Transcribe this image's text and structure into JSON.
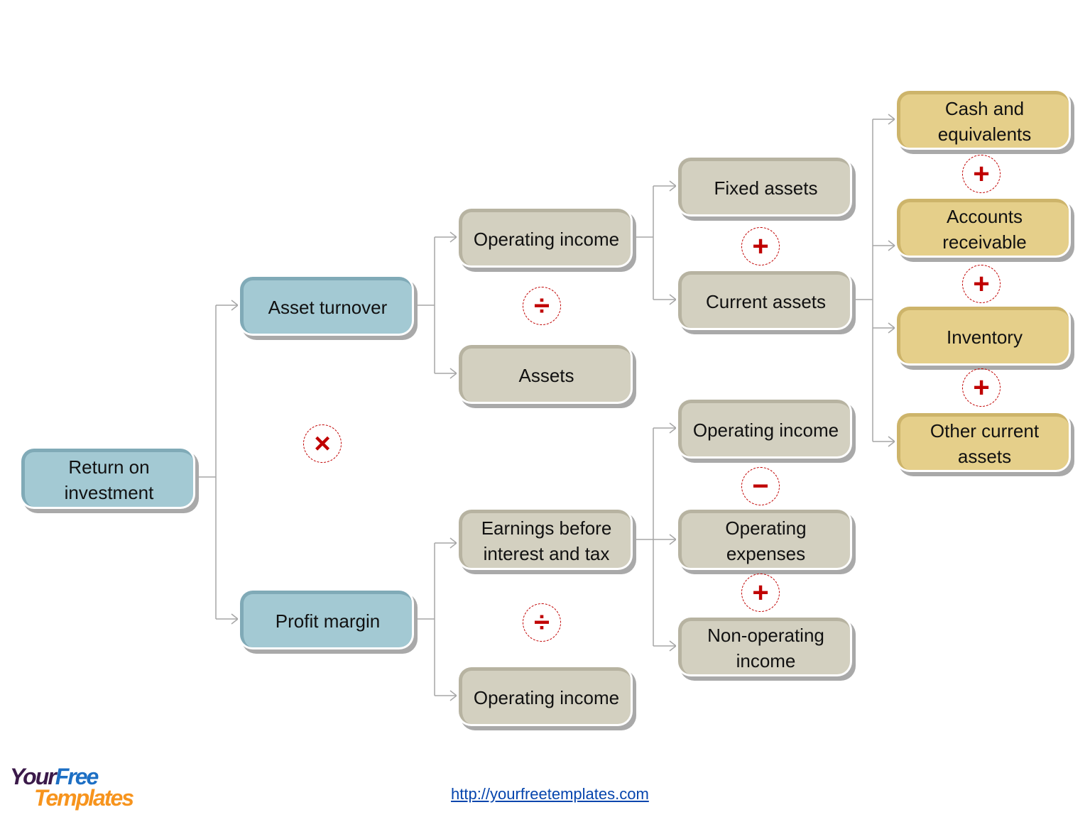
{
  "nodes": {
    "roi": "Return on investment",
    "asset_turnover": "Asset turnover",
    "profit_margin": "Profit margin",
    "operating_income_1": "Operating income",
    "assets": "Assets",
    "ebit": "Earnings before interest and tax",
    "operating_income_2": "Operating income",
    "fixed_assets": "Fixed assets",
    "current_assets": "Current assets",
    "operating_income_3": "Operating income",
    "operating_expenses": "Operating expenses",
    "non_operating_income": "Non-operating income",
    "cash": "Cash and equivalents",
    "accounts_receivable": "Accounts receivable",
    "inventory": "Inventory",
    "other_current_assets": "Other current assets"
  },
  "operators": {
    "multiply": "×",
    "divide": "÷",
    "plus": "+",
    "minus": "−"
  },
  "colors": {
    "level1_2": "#a3c9d3",
    "level3_4": "#d3d0c0",
    "level5": "#e5cf8a",
    "operator": "#c00000",
    "connector": "#a6a6a6"
  },
  "footer": {
    "link": "http://yourfreetemplates.com",
    "logo_line1_a": "Your",
    "logo_line1_b": "Free",
    "logo_line2": "Templates"
  }
}
